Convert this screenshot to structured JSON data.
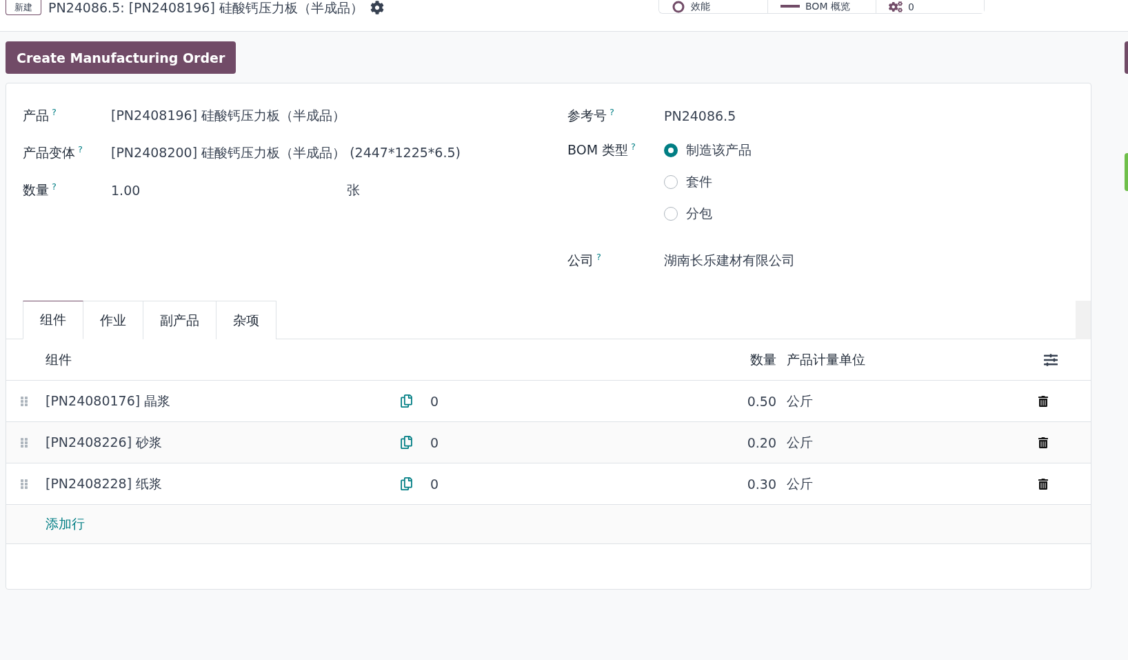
{
  "header": {
    "new_button": "新建",
    "title": "PN24086.5: [PN2408196] 硅酸钙压力板（半成品）",
    "smart_buttons": [
      {
        "kind": "efficiency",
        "label": "效能"
      },
      {
        "kind": "overview",
        "label": "BOM 概览"
      },
      {
        "kind": "operations",
        "label": "0"
      }
    ]
  },
  "action_button": "Create Manufacturing Order",
  "form": {
    "left": [
      {
        "label": "产品",
        "value": "[PN2408196] 硅酸钙压力板（半成品）"
      },
      {
        "label": "产品变体",
        "value": "[PN2408200] 硅酸钙压力板（半成品） (2447*1225*6.5)"
      },
      {
        "label": "数量",
        "value": "1.00",
        "unit": "张"
      }
    ],
    "reference": {
      "label": "参考号",
      "value": "PN24086.5"
    },
    "bom_type": {
      "label": "BOM 类型",
      "options": [
        {
          "label": "制造该产品",
          "selected": true
        },
        {
          "label": "套件",
          "selected": false
        },
        {
          "label": "分包",
          "selected": false
        }
      ]
    },
    "company": {
      "label": "公司",
      "value": "湖南长乐建材有限公司"
    },
    "help_mark": "?"
  },
  "tabs": [
    {
      "label": "组件",
      "selected": true
    },
    {
      "label": "作业",
      "selected": false
    },
    {
      "label": "副产品",
      "selected": false
    },
    {
      "label": "杂项",
      "selected": false
    }
  ],
  "table": {
    "columns": [
      "组件",
      "数量",
      "产品计量单位"
    ],
    "rows": [
      {
        "component": "[PN24080176] 晶浆",
        "count": "0",
        "quantity": "0.50",
        "uom": "公斤"
      },
      {
        "component": "[PN2408226] 砂浆",
        "count": "0",
        "quantity": "0.20",
        "uom": "公斤"
      },
      {
        "component": "[PN2408228] 纸浆",
        "count": "0",
        "quantity": "0.30",
        "uom": "公斤"
      }
    ],
    "add_line": "添加行"
  }
}
